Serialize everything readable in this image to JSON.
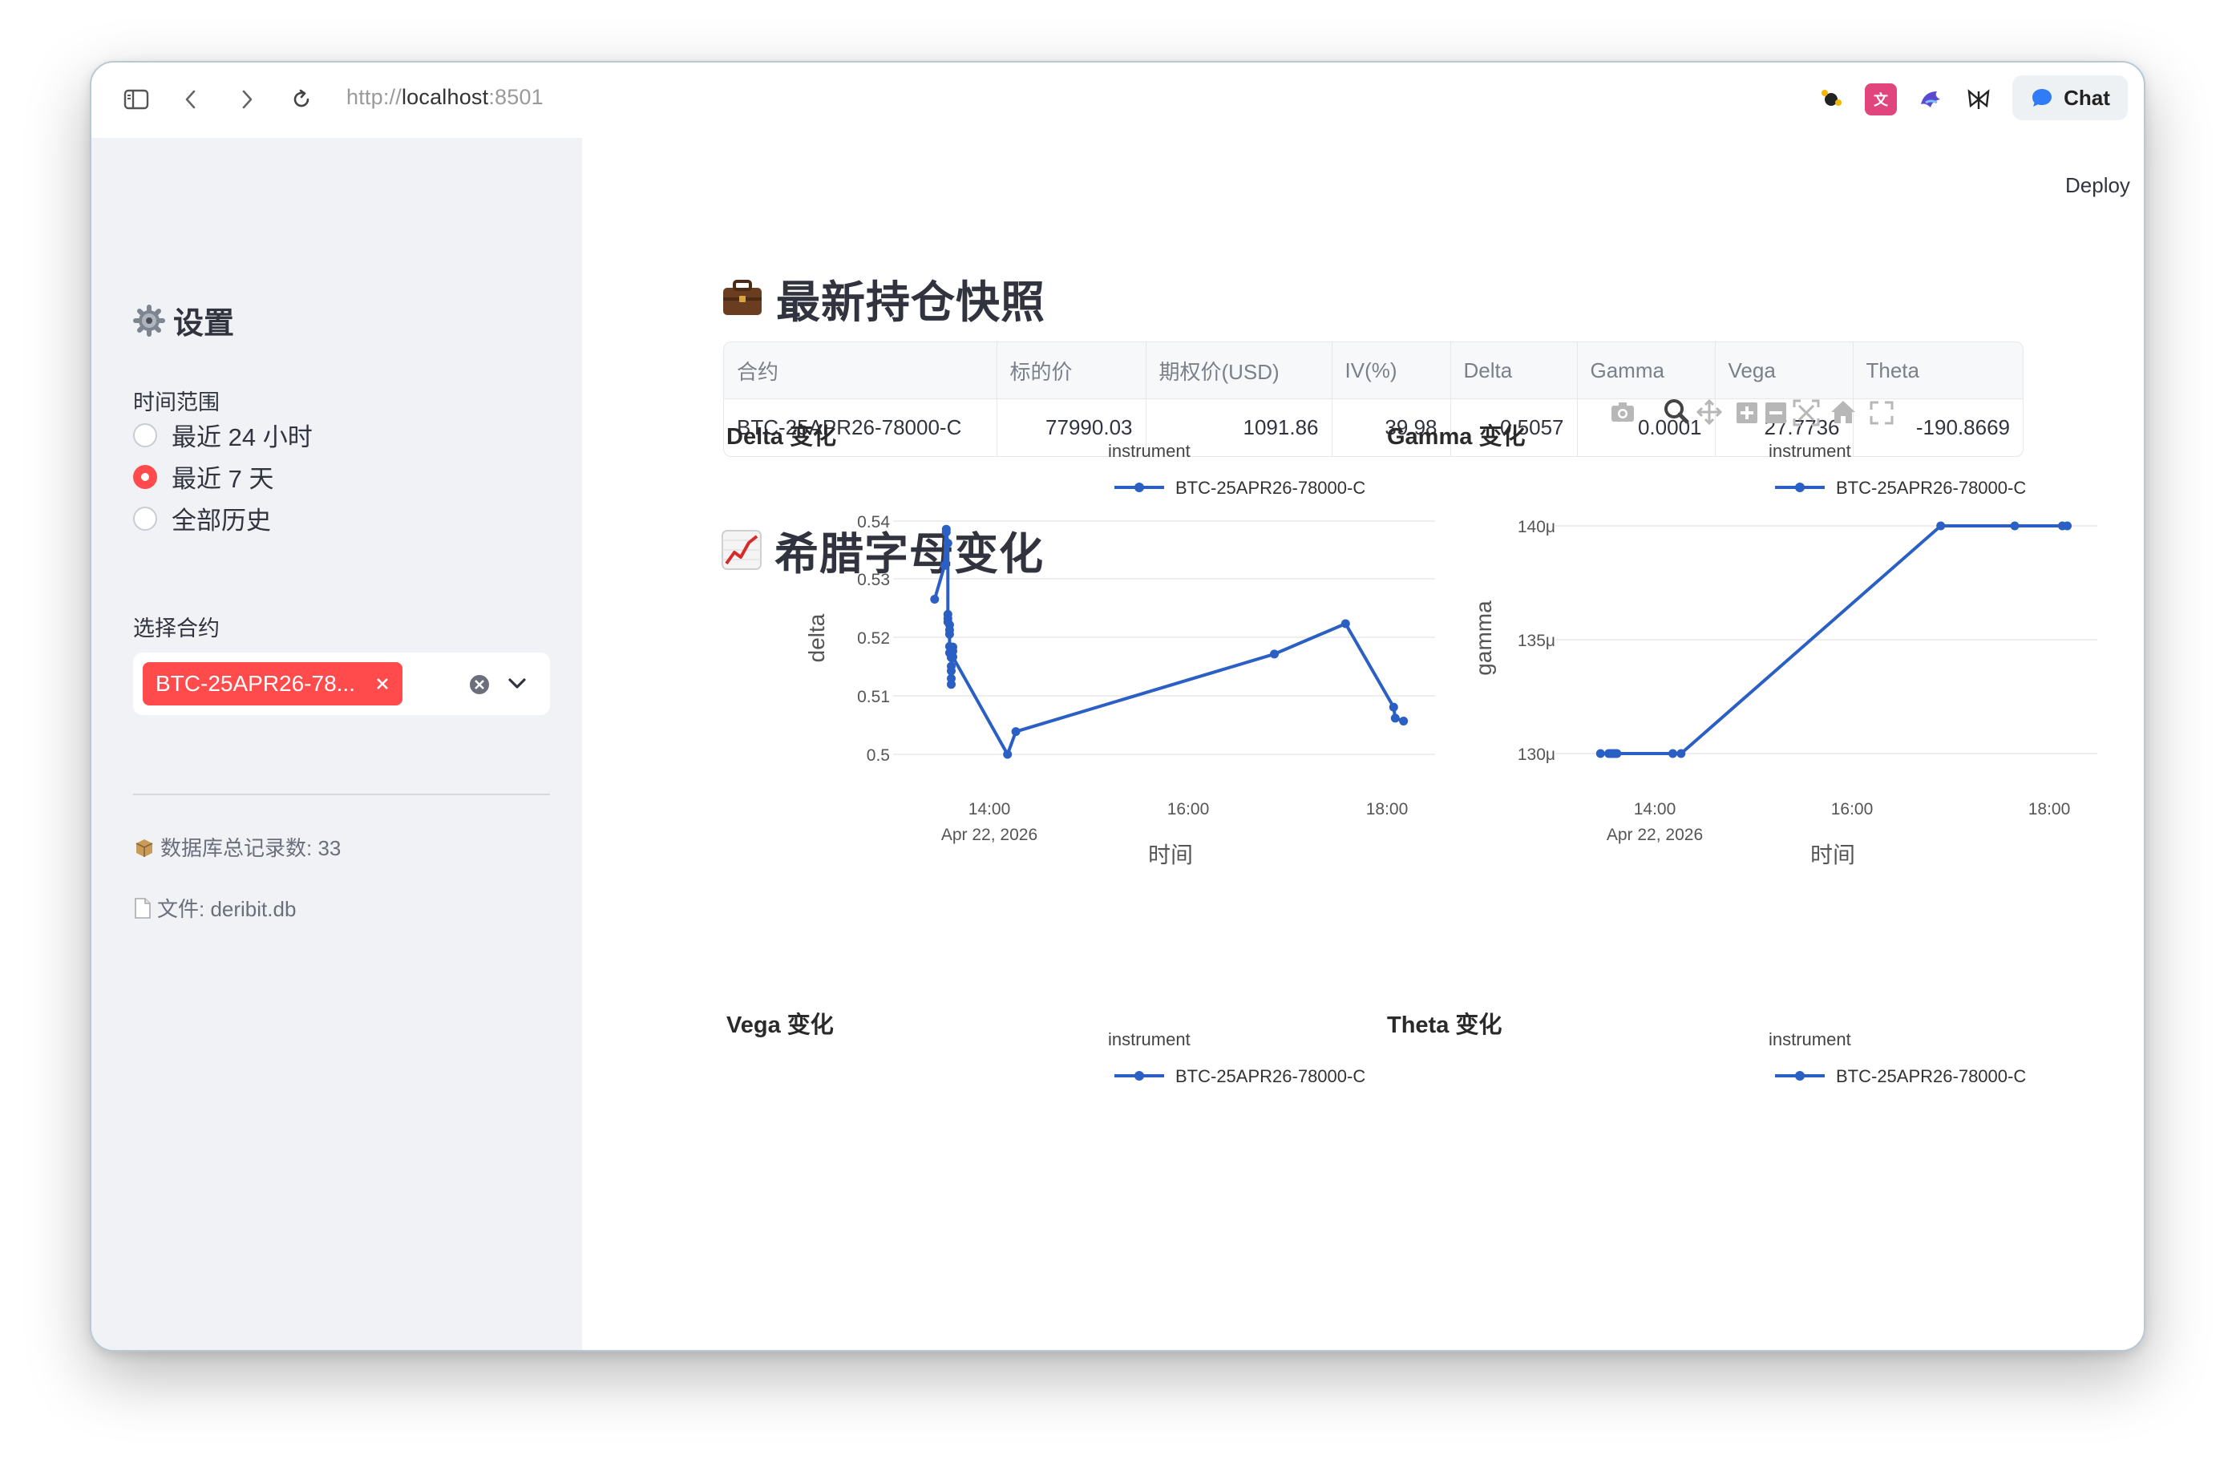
{
  "browser": {
    "url_prefix": "http://",
    "url_host": "localhost",
    "url_port": ":8501",
    "chat_label": "Chat"
  },
  "header": {
    "deploy_label": "Deploy"
  },
  "sidebar": {
    "title": "设置",
    "time_range_label": "时间范围",
    "time_options": [
      {
        "label": "最近 24 小时",
        "selected": false
      },
      {
        "label": "最近 7 天",
        "selected": true
      },
      {
        "label": "全部历史",
        "selected": false
      }
    ],
    "instrument_label": "选择合约",
    "selected_instrument": "BTC-25APR26-78...",
    "db_records": "数据库总记录数: 33",
    "db_file": "文件: deribit.db"
  },
  "snapshot": {
    "title": "最新持仓快照",
    "columns": [
      "合约",
      "标的价",
      "期权价(USD)",
      "IV(%)",
      "Delta",
      "Gamma",
      "Vega",
      "Theta"
    ],
    "rows": [
      [
        "BTC-25APR26-78000-C",
        "77990.03",
        "1091.86",
        "39.98",
        "0.5057",
        "0.0001",
        "27.7736",
        "-190.8669"
      ]
    ]
  },
  "greeks_section": {
    "title": "希腊字母变化"
  },
  "legend": {
    "title": "instrument",
    "series_name": "BTC-25APR26-78000-C"
  },
  "colors": {
    "accent": "#ff4b4b",
    "series": "#2a5fc4",
    "sidebar_bg": "#f0f2f6"
  },
  "chart_data": [
    {
      "type": "line",
      "title": "Delta 变化",
      "xlabel": "时间",
      "ylabel": "delta",
      "x_tick_labels": [
        "14:00",
        "16:00",
        "18:00"
      ],
      "x_date_label": "Apr 22, 2026",
      "y_tick_labels": [
        "0.54",
        "0.53",
        "0.52",
        "0.51",
        "0.5"
      ],
      "ylim": [
        0.5,
        0.54
      ],
      "series": [
        {
          "name": "BTC-25APR26-78000-C",
          "x": [
            "13:27",
            "13:33",
            "13:34",
            "13:34",
            "13:35",
            "13:35",
            "13:35",
            "13:35",
            "13:36",
            "13:36",
            "13:36",
            "13:36",
            "13:36",
            "13:37",
            "13:37",
            "13:37",
            "13:37",
            "13:37",
            "13:38",
            "13:38",
            "13:38",
            "14:11",
            "14:16",
            "16:52",
            "17:35",
            "18:04",
            "18:05",
            "18:10"
          ],
          "y": [
            0.5266,
            0.5324,
            0.5386,
            0.5381,
            0.5362,
            0.524,
            0.5233,
            0.5227,
            0.5222,
            0.5213,
            0.5206,
            0.5185,
            0.5174,
            0.5166,
            0.5151,
            0.5143,
            0.513,
            0.512,
            0.5184,
            0.5177,
            0.5167,
            0.5,
            0.5039,
            0.5172,
            0.5224,
            0.5081,
            0.5062,
            0.5057
          ]
        }
      ]
    },
    {
      "type": "line",
      "title": "Gamma 变化",
      "xlabel": "时间",
      "ylabel": "gamma",
      "x_tick_labels": [
        "14:00",
        "16:00",
        "18:00"
      ],
      "x_date_label": "Apr 22, 2026",
      "y_tick_labels": [
        "140μ",
        "135μ",
        "130μ"
      ],
      "ylim": [
        0.00013,
        0.00014
      ],
      "series": [
        {
          "name": "BTC-25APR26-78000-C",
          "x": [
            "13:27",
            "13:32",
            "13:33",
            "13:34",
            "13:35",
            "13:36",
            "13:37",
            "14:11",
            "14:16",
            "16:54",
            "17:39",
            "18:08",
            "18:11"
          ],
          "y": [
            0.00013,
            0.00013,
            0.00013,
            0.00013,
            0.00013,
            0.00013,
            0.00013,
            0.00013,
            0.00013,
            0.00014,
            0.00014,
            0.00014,
            0.00014
          ]
        }
      ]
    },
    {
      "type": "line",
      "title": "Vega 变化",
      "series": [
        {
          "name": "BTC-25APR26-78000-C"
        }
      ]
    },
    {
      "type": "line",
      "title": "Theta 变化",
      "series": [
        {
          "name": "BTC-25APR26-78000-C"
        }
      ]
    }
  ]
}
